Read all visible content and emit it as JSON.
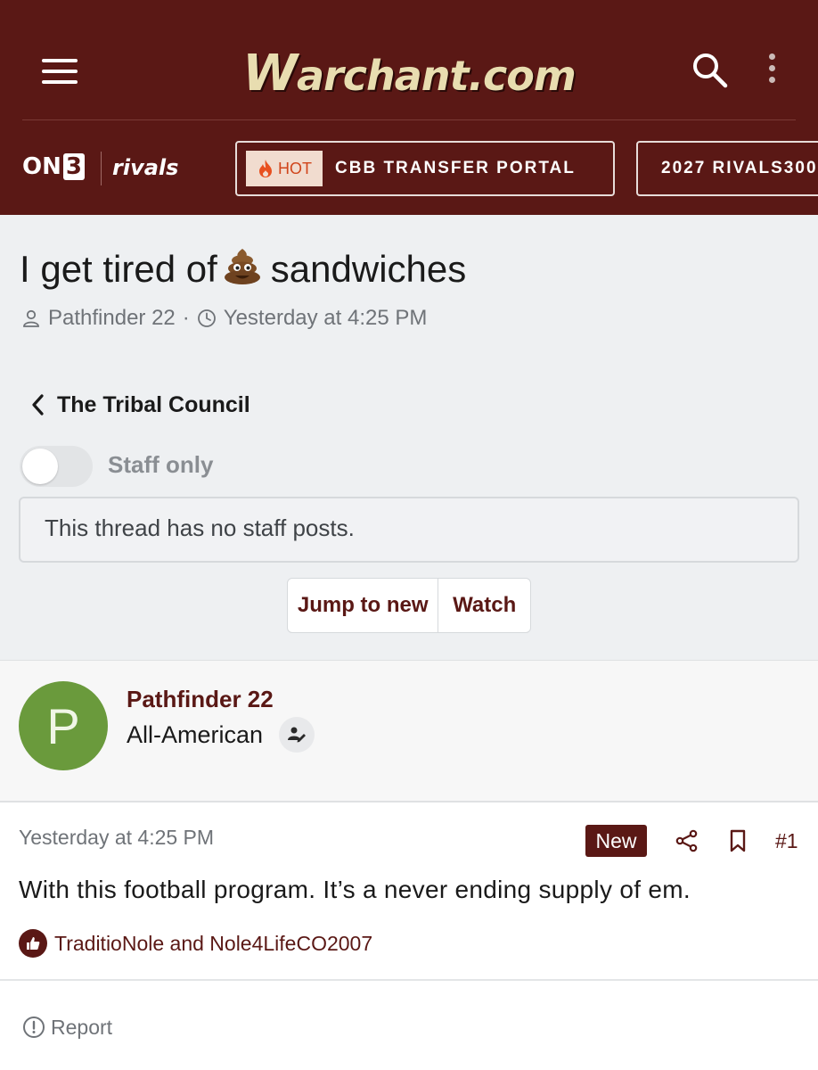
{
  "header": {
    "site_name_initial": "W",
    "site_name_rest": "archant.com",
    "network_logo_on": "ON",
    "network_logo_3": "3",
    "partner_logo": "rivals",
    "hot_badge": "HOT",
    "nav_pills": [
      "CBB TRANSFER PORTAL",
      "2027 RIVALS300"
    ]
  },
  "thread": {
    "title_before": "I get tired of",
    "title_after": "sandwiches",
    "author": "Pathfinder 22",
    "separator": "·",
    "date": "Yesterday at 4:25 PM",
    "forum": "The Tribal Council",
    "staff_only_label": "Staff only",
    "staff_notice": "This thread has no staff posts.",
    "jump_label": "Jump to new",
    "watch_label": "Watch"
  },
  "post": {
    "avatar_letter": "P",
    "username": "Pathfinder 22",
    "user_title": "All-American",
    "date": "Yesterday at 4:25 PM",
    "new_badge": "New",
    "number": "#1",
    "body": "With this football program. It’s a never ending supply of em.",
    "reactions": "TraditioNole and Nole4LifeCO2007",
    "report_label": "Report"
  },
  "colors": {
    "brand": "#5a1815",
    "logo_gold": "#e8ddb0",
    "avatar_green": "#6a9a3c",
    "hot_orange": "#d0451b"
  },
  "icons": [
    "menu-icon",
    "search-icon",
    "more-vertical-icon",
    "flame-icon",
    "poop-emoji",
    "user-icon",
    "clock-icon",
    "chevron-left-icon",
    "staff-badge-icon",
    "share-icon",
    "bookmark-icon",
    "thumbs-up-icon",
    "alert-circle-icon"
  ]
}
